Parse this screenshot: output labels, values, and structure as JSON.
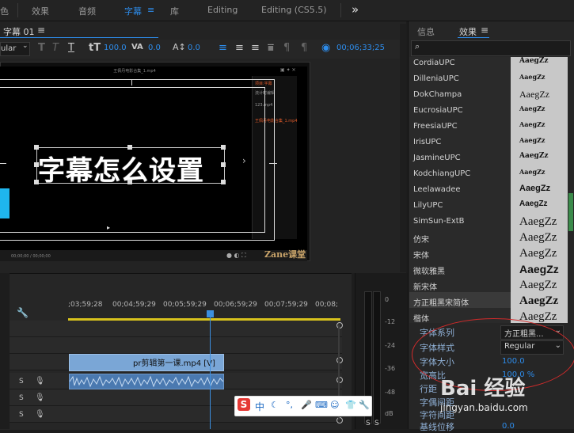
{
  "workspace_tabs": [
    {
      "label": "色",
      "active": false
    },
    {
      "label": "效果",
      "active": false
    },
    {
      "label": "音频",
      "active": false
    },
    {
      "label": "字幕",
      "active": true
    },
    {
      "label": "库",
      "active": false
    },
    {
      "label": "Editing",
      "active": false
    },
    {
      "label": "Editing (CS5.5)",
      "active": false
    }
  ],
  "overflow_label": "»",
  "title_panel": {
    "tab_label": "字幕 01",
    "font_style": "ular",
    "font_size": "100.0",
    "aspect": "0.0",
    "leading": "0.0",
    "timecode": "00;06;33;25"
  },
  "monitor": {
    "video_title": "王佩丹电影合集_1.mp4",
    "caption_text": "字幕怎么设置",
    "side_items": [
      "项目:字幕",
      "流计时编辑",
      "123.mp4",
      "王佩丹电影合集_1.mp4"
    ],
    "player_time": "00;00;00 / 00;00;00",
    "watermark": "Zane课堂"
  },
  "timeline": {
    "timecodes": [
      ";03;59;28",
      "00;04;59;29",
      "00;05;59;29",
      "00;06;59;29",
      "00;07;59;29",
      "00;08;"
    ],
    "video_clip_label": "pr剪辑第一课.mp4 [V]",
    "tracks": [
      {
        "s": "S"
      },
      {
        "s": "S"
      },
      {
        "s": "S"
      }
    ]
  },
  "meter": {
    "db_labels": [
      "0",
      "-12",
      "-24",
      "-36",
      "-48",
      "dB"
    ],
    "footer": [
      "S",
      "S"
    ]
  },
  "ime": {
    "logo": "S",
    "mode": "中"
  },
  "effects_panel": {
    "tabs": [
      {
        "label": "信息",
        "active": false
      },
      {
        "label": "效果",
        "active": true
      }
    ],
    "search_placeholder": "",
    "fonts": [
      {
        "name": "CordiaUPC",
        "preview": "AaegZz"
      },
      {
        "name": "DilleniaUPC",
        "preview": "AaegZz"
      },
      {
        "name": "DokChampa",
        "preview": "AaegZz"
      },
      {
        "name": "EucrosiaUPC",
        "preview": "AaegZz"
      },
      {
        "name": "FreesiaUPC",
        "preview": "AaegZz"
      },
      {
        "name": "IrisUPC",
        "preview": "AaegZz"
      },
      {
        "name": "JasmineUPC",
        "preview": "AaegZz"
      },
      {
        "name": "KodchiangUPC",
        "preview": "AaegZz"
      },
      {
        "name": "Leelawadee",
        "preview": "AaegZz"
      },
      {
        "name": "LilyUPC",
        "preview": "AaegZz"
      },
      {
        "name": "SimSun-ExtB",
        "preview": "AaegZz"
      },
      {
        "name": "仿宋",
        "preview": "AaegZz"
      },
      {
        "name": "宋体",
        "preview": "AaegZz"
      },
      {
        "name": "微软雅黑",
        "preview": "AaegZz"
      },
      {
        "name": "新宋体",
        "preview": "AaegZz"
      },
      {
        "name": "方正粗黑宋简体",
        "preview": "AaegZz"
      },
      {
        "name": "楷体",
        "preview": "AaegZz"
      }
    ],
    "properties": {
      "font_family_label": "字体系列",
      "font_family_value": "方正粗黑...",
      "font_style_label": "字体样式",
      "font_style_value": "Regular",
      "font_size_label": "字体大小",
      "font_size_value": "100.0",
      "aspect_label": "宽高比",
      "aspect_value": "100.0 %",
      "leading_label": "行距",
      "kerning_label": "字偶间距",
      "tracking_label": "字符间距",
      "baseline_label": "基线位移",
      "baseline_value": "0.0"
    },
    "accent_color": "#2d8ceb"
  },
  "overlay": {
    "baidu_text": "Bai 经验",
    "baidu_url": "jingyan.baidu.com"
  }
}
